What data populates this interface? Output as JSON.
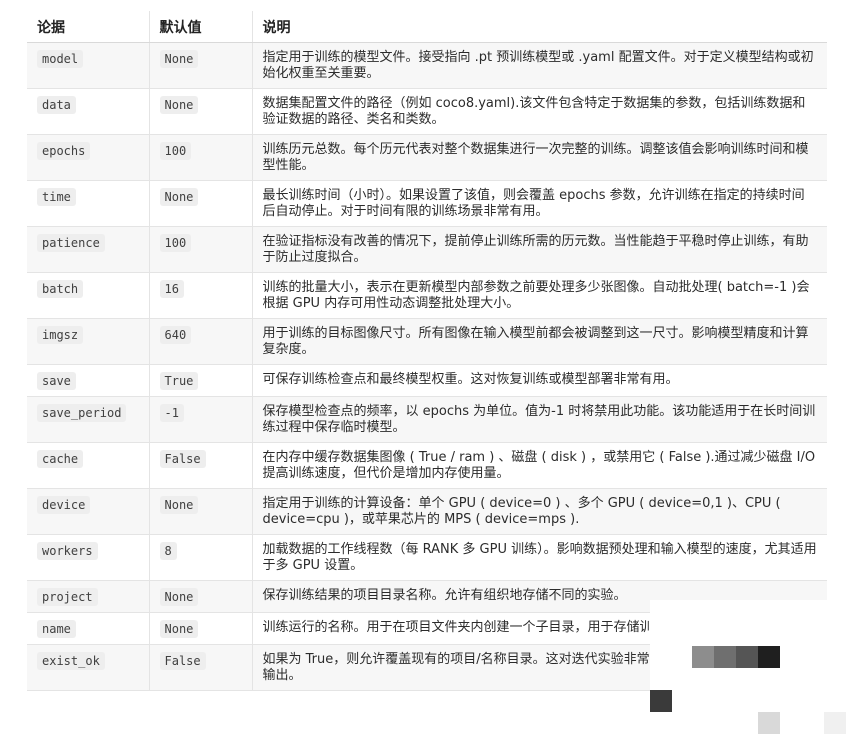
{
  "table": {
    "headers": [
      "论据",
      "默认值",
      "说明"
    ],
    "rows": [
      {
        "arg": "model",
        "default": "None",
        "desc": "指定用于训练的模型文件。接受指向 .pt 预训练模型或 .yaml 配置文件。对于定义模型结构或初始化权重至关重要。"
      },
      {
        "arg": "data",
        "default": "None",
        "desc": "数据集配置文件的路径（例如 coco8.yaml).该文件包含特定于数据集的参数，包括训练数据和验证数据的路径、类名和类数。"
      },
      {
        "arg": "epochs",
        "default": "100",
        "desc": "训练历元总数。每个历元代表对整个数据集进行一次完整的训练。调整该值会影响训练时间和模型性能。"
      },
      {
        "arg": "time",
        "default": "None",
        "desc": "最长训练时间（小时）。如果设置了该值，则会覆盖 epochs 参数，允许训练在指定的持续时间后自动停止。对于时间有限的训练场景非常有用。"
      },
      {
        "arg": "patience",
        "default": "100",
        "desc": "在验证指标没有改善的情况下，提前停止训练所需的历元数。当性能趋于平稳时停止训练，有助于防止过度拟合。"
      },
      {
        "arg": "batch",
        "default": "16",
        "desc": "训练的批量大小，表示在更新模型内部参数之前要处理多少张图像。自动批处理( batch=-1 )会根据 GPU 内存可用性动态调整批处理大小。"
      },
      {
        "arg": "imgsz",
        "default": "640",
        "desc": "用于训练的目标图像尺寸。所有图像在输入模型前都会被调整到这一尺寸。影响模型精度和计算复杂度。"
      },
      {
        "arg": "save",
        "default": "True",
        "desc": "可保存训练检查点和最终模型权重。这对恢复训练或模型部署非常有用。"
      },
      {
        "arg": "save_period",
        "default": "-1",
        "desc": "保存模型检查点的频率，以 epochs 为单位。值为-1 时将禁用此功能。该功能适用于在长时间训练过程中保存临时模型。"
      },
      {
        "arg": "cache",
        "default": "False",
        "desc": "在内存中缓存数据集图像 ( True / ram ) 、磁盘 ( disk ) ，或禁用它 ( False ).通过减少磁盘 I/O 提高训练速度，但代价是增加内存使用量。"
      },
      {
        "arg": "device",
        "default": "None",
        "desc": "指定用于训练的计算设备：单个 GPU ( device=0 ) 、多个 GPU ( device=0,1 )、CPU ( device=cpu )，或苹果芯片的 MPS ( device=mps )."
      },
      {
        "arg": "workers",
        "default": "8",
        "desc": "加载数据的工作线程数（每 RANK 多 GPU 训练）。影响数据预处理和输入模型的速度，尤其适用于多 GPU 设置。"
      },
      {
        "arg": "project",
        "default": "None",
        "desc": "保存训练结果的项目目录名称。允许有组织地存储不同的实验。"
      },
      {
        "arg": "name",
        "default": "None",
        "desc": "训练运行的名称。用于在项目文件夹内创建一个子目录，用于存储训练日志和结果。"
      },
      {
        "arg": "exist_ok",
        "default": "False",
        "desc": "如果为 True，则允许覆盖现有的项目/名称目录。这对迭代实验非常有用，无需手动清除之前的输出。"
      }
    ]
  },
  "mosaic_colors": [
    "#8d8d8d",
    "#6f6f6f",
    "#555555",
    "#3a3a3a",
    "#1f1f1f",
    "#d9d9d9",
    "#f0f0f0"
  ]
}
